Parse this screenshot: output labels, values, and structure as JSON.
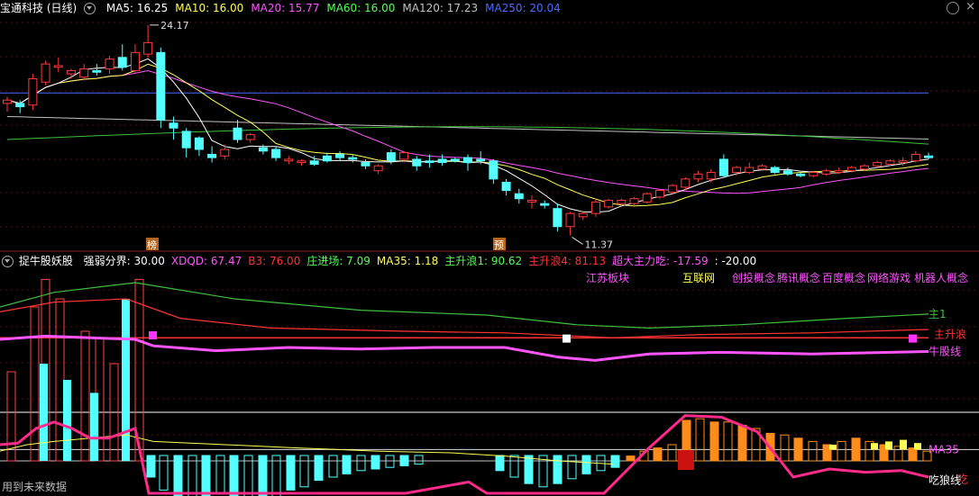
{
  "upper": {
    "title": "宝通科技 (日线)",
    "ma": [
      {
        "label": "MA5: 16.25",
        "color": "#ffffff"
      },
      {
        "label": "MA10: 16.00",
        "color": "#ffff55"
      },
      {
        "label": "MA20: 15.77",
        "color": "#ff55ff"
      },
      {
        "label": "MA60: 16.00",
        "color": "#55ff55"
      },
      {
        "label": "MA120: 17.23",
        "color": "#c0c0c0"
      },
      {
        "label": "MA250: 20.04",
        "color": "#4b6bff"
      }
    ],
    "high_label": "24.17",
    "low_label": "11.37",
    "marker1": "榜",
    "marker2": "预"
  },
  "lower": {
    "title": "捉牛股妖股",
    "items": [
      {
        "label": "强弱分界: 30.00",
        "color": "#ffffff"
      },
      {
        "label": "XDQD: 67.47",
        "color": "#ff55ff"
      },
      {
        "label": "B3: 76.00",
        "color": "#ff3333"
      },
      {
        "label": "庄进场: 7.09",
        "color": "#55ff55"
      },
      {
        "label": "MA35: 1.18",
        "color": "#ffff55"
      },
      {
        "label": "主升浪1: 90.62",
        "color": "#55ff55"
      },
      {
        "label": "主升浪4: 81.13",
        "color": "#ff3333"
      },
      {
        "label": "超大主力吃: -17.59",
        "color": "#ff55ff"
      },
      {
        "label": ": -20.00",
        "color": "#ffffff"
      }
    ],
    "concepts": [
      {
        "label": "江苏板块",
        "color": "#ff55ff"
      },
      {
        "label": "互联网",
        "color": "#ffff55"
      },
      {
        "label": "创投概念",
        "color": "#ff55ff"
      },
      {
        "label": "腾讯概念",
        "color": "#ff55ff"
      },
      {
        "label": "百度概念",
        "color": "#ff55ff"
      },
      {
        "label": "网络游戏",
        "color": "#ff55ff"
      },
      {
        "label": "机器人概念",
        "color": "#ff55ff"
      }
    ],
    "right_labels": {
      "zhu1": "主1",
      "zhusheng": "主升浪",
      "niugu": "牛股线",
      "ma35": "MA35",
      "chilang": "吃狼线",
      "chi": "吃"
    }
  },
  "footer": "用到未来数据",
  "chart_data": [
    {
      "type": "candlestick",
      "title": "宝通科技 (日线)",
      "high": 24.17,
      "low": 11.37,
      "candles": [
        [
          19.4,
          19.8,
          18.9,
          19.6
        ],
        [
          19.4,
          19.6,
          18.8,
          19.2
        ],
        [
          19.3,
          21.2,
          19.0,
          20.9
        ],
        [
          20.7,
          22.0,
          20.5,
          21.8
        ],
        [
          21.6,
          22.2,
          21.3,
          21.7
        ],
        [
          21.2,
          21.5,
          20.9,
          21.4
        ],
        [
          21.0,
          21.8,
          20.8,
          21.5
        ],
        [
          21.4,
          21.8,
          21.1,
          21.3
        ],
        [
          21.5,
          22.3,
          21.2,
          22.1
        ],
        [
          22.2,
          23.0,
          21.4,
          21.6
        ],
        [
          21.4,
          23.0,
          21.2,
          22.5
        ],
        [
          22.4,
          24.17,
          22.2,
          23.1
        ],
        [
          22.5,
          22.8,
          17.9,
          18.4
        ],
        [
          18.2,
          18.6,
          17.2,
          17.9
        ],
        [
          17.7,
          17.9,
          16.1,
          16.7
        ],
        [
          17.3,
          17.4,
          16.2,
          16.6
        ],
        [
          16.3,
          16.8,
          15.8,
          16.1
        ],
        [
          16.2,
          16.9,
          16.0,
          16.6
        ],
        [
          17.9,
          18.4,
          17.0,
          17.2
        ],
        [
          17.2,
          17.6,
          17.0,
          17.5
        ],
        [
          16.7,
          16.9,
          16.3,
          16.5
        ],
        [
          16.6,
          16.8,
          15.9,
          16.1
        ],
        [
          15.9,
          16.2,
          15.7,
          16.0
        ],
        [
          15.8,
          16.0,
          15.6,
          15.9
        ],
        [
          15.9,
          16.2,
          15.6,
          15.7
        ],
        [
          16.2,
          16.4,
          15.8,
          15.9
        ],
        [
          16.3,
          16.5,
          15.9,
          16.1
        ],
        [
          16.1,
          16.3,
          15.8,
          16.0
        ],
        [
          15.8,
          16.0,
          15.4,
          15.6
        ],
        [
          15.3,
          15.7,
          15.1,
          15.6
        ],
        [
          16.4,
          16.6,
          15.7,
          15.9
        ],
        [
          16.0,
          16.5,
          15.8,
          16.4
        ],
        [
          16.0,
          16.2,
          15.3,
          15.6
        ],
        [
          15.9,
          16.3,
          15.5,
          15.8
        ],
        [
          16.0,
          16.3,
          15.6,
          15.8
        ],
        [
          16.0,
          16.1,
          15.8,
          15.9
        ],
        [
          16.1,
          16.3,
          15.3,
          15.8
        ],
        [
          16.0,
          16.5,
          15.7,
          15.9
        ],
        [
          15.9,
          16.0,
          14.5,
          14.8
        ],
        [
          14.6,
          14.8,
          13.8,
          14.1
        ],
        [
          13.9,
          14.2,
          13.3,
          13.6
        ],
        [
          13.4,
          13.8,
          13.0,
          13.5
        ],
        [
          13.3,
          13.5,
          13.0,
          13.2
        ],
        [
          13.0,
          13.3,
          11.6,
          11.9
        ],
        [
          11.9,
          12.8,
          11.37,
          12.7
        ],
        [
          12.5,
          12.8,
          12.3,
          12.7
        ],
        [
          12.7,
          13.6,
          12.5,
          13.4
        ],
        [
          13.1,
          13.6,
          13.0,
          13.5
        ],
        [
          13.3,
          13.6,
          13.1,
          13.5
        ],
        [
          13.3,
          13.7,
          13.1,
          13.6
        ],
        [
          13.4,
          14.0,
          13.3,
          13.9
        ],
        [
          13.7,
          14.2,
          13.6,
          14.1
        ],
        [
          14.0,
          14.5,
          13.9,
          14.4
        ],
        [
          14.3,
          14.9,
          14.1,
          14.8
        ],
        [
          14.8,
          15.3,
          14.6,
          15.1
        ],
        [
          14.8,
          15.4,
          14.6,
          15.2
        ],
        [
          16.0,
          16.3,
          14.9,
          15.0
        ],
        [
          15.2,
          15.6,
          15.0,
          15.5
        ],
        [
          15.2,
          15.8,
          15.1,
          15.5
        ],
        [
          15.4,
          15.7,
          15.3,
          15.6
        ],
        [
          15.5,
          15.6,
          15.1,
          15.2
        ],
        [
          15.3,
          15.5,
          15.0,
          15.1
        ],
        [
          15.1,
          15.2,
          14.9,
          15.0
        ],
        [
          15.0,
          15.3,
          14.9,
          15.2
        ],
        [
          15.1,
          15.4,
          15.0,
          15.3
        ],
        [
          15.2,
          15.5,
          15.1,
          15.3
        ],
        [
          15.3,
          15.6,
          15.2,
          15.5
        ],
        [
          15.4,
          15.7,
          15.3,
          15.6
        ],
        [
          15.6,
          15.9,
          15.5,
          15.8
        ],
        [
          15.7,
          16.0,
          15.6,
          15.9
        ],
        [
          15.8,
          16.1,
          15.6,
          15.9
        ],
        [
          15.9,
          16.5,
          15.8,
          16.3
        ],
        [
          16.2,
          16.4,
          16.0,
          16.1
        ]
      ]
    },
    {
      "type": "bar",
      "title": "捉牛股妖股",
      "series": [
        {
          "name": "强弱分界",
          "values": [
            30
          ]
        },
        {
          "name": "XDQD",
          "values": [
            67.47
          ]
        },
        {
          "name": "B3",
          "values": [
            76
          ]
        },
        {
          "name": "庄进场",
          "values": [
            7.09
          ]
        },
        {
          "name": "MA35",
          "values": [
            1.18
          ]
        },
        {
          "name": "主升浪1",
          "values": [
            90.62
          ]
        },
        {
          "name": "主升浪4",
          "values": [
            81.13
          ]
        },
        {
          "name": "超大主力吃",
          "values": [
            -17.59
          ]
        }
      ]
    }
  ]
}
